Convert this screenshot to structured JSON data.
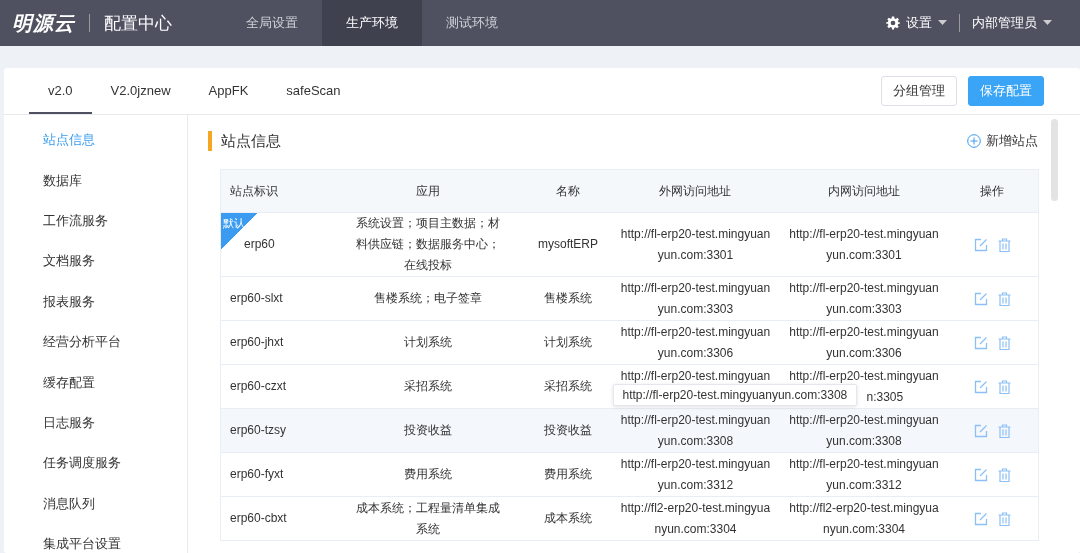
{
  "header": {
    "logo": "明源云",
    "title": "配置中心",
    "nav": [
      {
        "label": "全局设置",
        "selected": false
      },
      {
        "label": "生产环境",
        "selected": true
      },
      {
        "label": "测试环境",
        "selected": false
      }
    ],
    "settings": "设置",
    "user": "内部管理员"
  },
  "tabs": [
    {
      "label": "v2.0",
      "selected": true
    },
    {
      "label": "V2.0jznew",
      "selected": false
    },
    {
      "label": "AppFK",
      "selected": false
    },
    {
      "label": "safeScan",
      "selected": false
    }
  ],
  "actions": [
    {
      "label": "分组管理",
      "kind": "default"
    },
    {
      "label": "保存配置",
      "kind": "primary"
    }
  ],
  "sidebar": {
    "items": [
      {
        "label": "站点信息",
        "selected": true
      },
      {
        "label": "数据库",
        "selected": false
      },
      {
        "label": "工作流服务",
        "selected": false
      },
      {
        "label": "文档服务",
        "selected": false
      },
      {
        "label": "报表服务",
        "selected": false
      },
      {
        "label": "经营分析平台",
        "selected": false
      },
      {
        "label": "缓存配置",
        "selected": false
      },
      {
        "label": "日志服务",
        "selected": false
      },
      {
        "label": "任务调度服务",
        "selected": false
      },
      {
        "label": "消息队列",
        "selected": false
      },
      {
        "label": "集成平台设置",
        "selected": false
      }
    ]
  },
  "section": {
    "title": "站点信息",
    "add": "新增站点"
  },
  "table": {
    "columns": [
      "站点标识",
      "应用",
      "名称",
      "外网访问地址",
      "内网访问地址",
      "操作"
    ],
    "rows": [
      {
        "id": "erp60",
        "default": true,
        "default_label": "默认",
        "hovered": false,
        "app": "系统设置；项目主数据；材料供应链；数据服务中心；在线投标",
        "name": "mysoftERP",
        "outer": [
          "http://fl-erp20-test.mingyuan",
          "yun.com:3301"
        ],
        "inner": [
          "http://fl-erp20-test.mingyuan",
          "yun.com:3301"
        ]
      },
      {
        "id": "erp60-slxt",
        "default": false,
        "hovered": false,
        "app": "售楼系统；电子签章",
        "name": "售楼系统",
        "outer": [
          "http://fl-erp20-test.mingyuan",
          "yun.com:3303"
        ],
        "inner": [
          "http://fl-erp20-test.mingyuan",
          "yun.com:3303"
        ]
      },
      {
        "id": "erp60-jhxt",
        "default": false,
        "hovered": false,
        "app": "计划系统",
        "name": "计划系统",
        "outer": [
          "http://fl-erp20-test.mingyuan",
          "yun.com:3306"
        ],
        "inner": [
          "http://fl-erp20-test.mingyuan",
          "yun.com:3306"
        ]
      },
      {
        "id": "erp60-czxt",
        "default": false,
        "hovered": false,
        "app": "采招系统",
        "name": "采招系统",
        "outer": [
          "http://fl-erp20-test.mingyuan"
        ],
        "inner": [
          "http://fl-erp20-test.mingyuan",
          "n:3305"
        ]
      },
      {
        "id": "erp60-tzsy",
        "default": false,
        "hovered": true,
        "tooltip": "http://fl-erp20-test.mingyuanyun.com:3308",
        "app": "投资收益",
        "name": "投资收益",
        "outer": [
          "http://fl-erp20-test.mingyuan",
          "yun.com:3308"
        ],
        "inner": [
          "http://fl-erp20-test.mingyuan",
          "yun.com:3308"
        ]
      },
      {
        "id": "erp60-fyxt",
        "default": false,
        "hovered": false,
        "app": "费用系统",
        "name": "费用系统",
        "outer": [
          "http://fl-erp20-test.mingyuan",
          "yun.com:3312"
        ],
        "inner": [
          "http://fl-erp20-test.mingyuan",
          "yun.com:3312"
        ]
      },
      {
        "id": "erp60-cbxt",
        "default": false,
        "hovered": false,
        "app": "成本系统；工程量清单集成系统",
        "name": "成本系统",
        "outer": [
          "http://fl2-erp20-test.mingyua",
          "nyun.com:3304"
        ],
        "inner": [
          "http://fl2-erp20-test.mingyua",
          "nyun.com:3304"
        ]
      }
    ]
  }
}
